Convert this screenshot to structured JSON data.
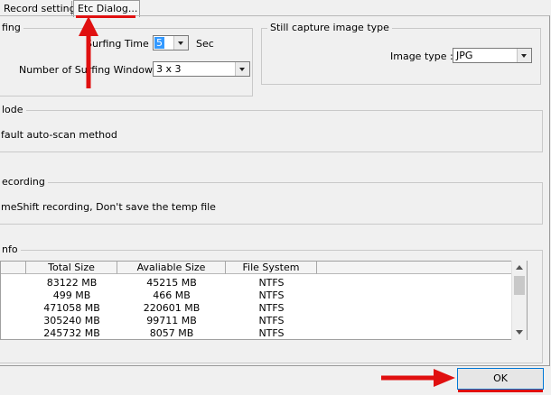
{
  "tabs": [
    "Record setting",
    "Etc Dialog..."
  ],
  "surfing": {
    "legend": "fing",
    "time_label": "Surfing Time :",
    "time_value": "5",
    "time_unit": "Sec",
    "windows_label": "Number of Surfing Windows :",
    "windows_value": "3 x 3"
  },
  "still_capture": {
    "legend": "Still capture image type",
    "type_label": "Image type :",
    "type_value": "JPG"
  },
  "mode": {
    "legend": "lode",
    "text": "fault auto-scan method"
  },
  "recording": {
    "legend": "ecording",
    "text": "meShift recording, Don't save the temp file"
  },
  "info": {
    "legend": "nfo",
    "columns": [
      "",
      "Total Size",
      "Avaliable Size",
      "File System"
    ],
    "rows": [
      [
        "83122 MB",
        "45215 MB",
        "NTFS"
      ],
      [
        "499 MB",
        "466 MB",
        "NTFS"
      ],
      [
        "471058 MB",
        "220601 MB",
        "NTFS"
      ],
      [
        "305240 MB",
        "99711 MB",
        "NTFS"
      ],
      [
        "245732 MB",
        "8057 MB",
        "NTFS"
      ]
    ]
  },
  "ok_label": "OK",
  "accent_color": "#e01010"
}
